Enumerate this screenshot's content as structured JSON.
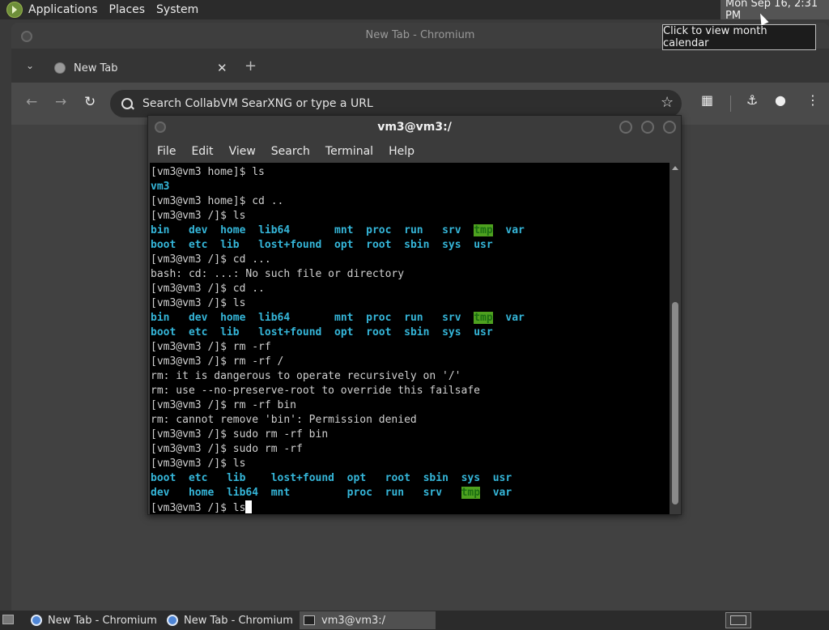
{
  "top_panel": {
    "menus": [
      "Applications",
      "Places",
      "System"
    ],
    "clock": "Mon Sep 16,  2:31 PM",
    "tooltip": "Click to view month calendar"
  },
  "chromium": {
    "window_title": "New Tab - Chromium",
    "tab_label": "New Tab",
    "tab_close": "✕",
    "new_tab": "+",
    "omnibox_placeholder": "Search CollabVM SearXNG or type a URL",
    "icons": [
      "back-arrow-icon",
      "forward-arrow-icon",
      "reload-icon",
      "search-icon",
      "bookmark-star-icon",
      "extensions-icon",
      "labs-flask-icon",
      "profile-icon",
      "menu-dots-icon"
    ]
  },
  "terminal": {
    "title": "vm3@vm3:/",
    "menus": [
      "File",
      "Edit",
      "View",
      "Search",
      "Terminal",
      "Help"
    ],
    "lines": [
      [
        {
          "t": "[vm3@vm3 home]$ ls"
        }
      ],
      [
        {
          "t": "vm3",
          "c": "dir"
        }
      ],
      [
        {
          "t": "[vm3@vm3 home]$ cd .."
        }
      ],
      [
        {
          "t": "[vm3@vm3 /]$ ls"
        }
      ],
      [
        {
          "t": "bin",
          "c": "dir"
        },
        {
          "t": "   "
        },
        {
          "t": "dev",
          "c": "dir"
        },
        {
          "t": "  "
        },
        {
          "t": "home",
          "c": "dir"
        },
        {
          "t": "  "
        },
        {
          "t": "lib64",
          "c": "dir"
        },
        {
          "t": "       "
        },
        {
          "t": "mnt",
          "c": "dir"
        },
        {
          "t": "  "
        },
        {
          "t": "proc",
          "c": "dir"
        },
        {
          "t": "  "
        },
        {
          "t": "run",
          "c": "dir"
        },
        {
          "t": "   "
        },
        {
          "t": "srv",
          "c": "dir"
        },
        {
          "t": "  "
        },
        {
          "t": "tmp",
          "c": "tmp"
        },
        {
          "t": "  "
        },
        {
          "t": "var",
          "c": "dir"
        }
      ],
      [
        {
          "t": "boot",
          "c": "dir"
        },
        {
          "t": "  "
        },
        {
          "t": "etc",
          "c": "dir"
        },
        {
          "t": "  "
        },
        {
          "t": "lib",
          "c": "dir"
        },
        {
          "t": "   "
        },
        {
          "t": "lost+found",
          "c": "dir"
        },
        {
          "t": "  "
        },
        {
          "t": "opt",
          "c": "dir"
        },
        {
          "t": "  "
        },
        {
          "t": "root",
          "c": "dir"
        },
        {
          "t": "  "
        },
        {
          "t": "sbin",
          "c": "dir"
        },
        {
          "t": "  "
        },
        {
          "t": "sys",
          "c": "dir"
        },
        {
          "t": "  "
        },
        {
          "t": "usr",
          "c": "dir"
        }
      ],
      [
        {
          "t": "[vm3@vm3 /]$ cd ..."
        }
      ],
      [
        {
          "t": "bash: cd: ...: No such file or directory"
        }
      ],
      [
        {
          "t": "[vm3@vm3 /]$ cd .."
        }
      ],
      [
        {
          "t": "[vm3@vm3 /]$ ls"
        }
      ],
      [
        {
          "t": "bin",
          "c": "dir"
        },
        {
          "t": "   "
        },
        {
          "t": "dev",
          "c": "dir"
        },
        {
          "t": "  "
        },
        {
          "t": "home",
          "c": "dir"
        },
        {
          "t": "  "
        },
        {
          "t": "lib64",
          "c": "dir"
        },
        {
          "t": "       "
        },
        {
          "t": "mnt",
          "c": "dir"
        },
        {
          "t": "  "
        },
        {
          "t": "proc",
          "c": "dir"
        },
        {
          "t": "  "
        },
        {
          "t": "run",
          "c": "dir"
        },
        {
          "t": "   "
        },
        {
          "t": "srv",
          "c": "dir"
        },
        {
          "t": "  "
        },
        {
          "t": "tmp",
          "c": "tmp"
        },
        {
          "t": "  "
        },
        {
          "t": "var",
          "c": "dir"
        }
      ],
      [
        {
          "t": "boot",
          "c": "dir"
        },
        {
          "t": "  "
        },
        {
          "t": "etc",
          "c": "dir"
        },
        {
          "t": "  "
        },
        {
          "t": "lib",
          "c": "dir"
        },
        {
          "t": "   "
        },
        {
          "t": "lost+found",
          "c": "dir"
        },
        {
          "t": "  "
        },
        {
          "t": "opt",
          "c": "dir"
        },
        {
          "t": "  "
        },
        {
          "t": "root",
          "c": "dir"
        },
        {
          "t": "  "
        },
        {
          "t": "sbin",
          "c": "dir"
        },
        {
          "t": "  "
        },
        {
          "t": "sys",
          "c": "dir"
        },
        {
          "t": "  "
        },
        {
          "t": "usr",
          "c": "dir"
        }
      ],
      [
        {
          "t": "[vm3@vm3 /]$ rm -rf"
        }
      ],
      [
        {
          "t": "[vm3@vm3 /]$ rm -rf /"
        }
      ],
      [
        {
          "t": "rm: it is dangerous to operate recursively on '/'"
        }
      ],
      [
        {
          "t": "rm: use --no-preserve-root to override this failsafe"
        }
      ],
      [
        {
          "t": "[vm3@vm3 /]$ rm -rf bin"
        }
      ],
      [
        {
          "t": "rm: cannot remove 'bin': Permission denied"
        }
      ],
      [
        {
          "t": "[vm3@vm3 /]$ sudo rm -rf bin"
        }
      ],
      [
        {
          "t": "[vm3@vm3 /]$ sudo rm -rf"
        }
      ],
      [
        {
          "t": "[vm3@vm3 /]$ ls"
        }
      ],
      [
        {
          "t": "boot",
          "c": "dir"
        },
        {
          "t": "  "
        },
        {
          "t": "etc",
          "c": "dir"
        },
        {
          "t": "   "
        },
        {
          "t": "lib",
          "c": "dir"
        },
        {
          "t": "    "
        },
        {
          "t": "lost+found",
          "c": "dir"
        },
        {
          "t": "  "
        },
        {
          "t": "opt",
          "c": "dir"
        },
        {
          "t": "   "
        },
        {
          "t": "root",
          "c": "dir"
        },
        {
          "t": "  "
        },
        {
          "t": "sbin",
          "c": "dir"
        },
        {
          "t": "  "
        },
        {
          "t": "sys",
          "c": "dir"
        },
        {
          "t": "  "
        },
        {
          "t": "usr",
          "c": "dir"
        }
      ],
      [
        {
          "t": "dev",
          "c": "dir"
        },
        {
          "t": "   "
        },
        {
          "t": "home",
          "c": "dir"
        },
        {
          "t": "  "
        },
        {
          "t": "lib64",
          "c": "dir"
        },
        {
          "t": "  "
        },
        {
          "t": "mnt",
          "c": "dir"
        },
        {
          "t": "         "
        },
        {
          "t": "proc",
          "c": "dir"
        },
        {
          "t": "  "
        },
        {
          "t": "run",
          "c": "dir"
        },
        {
          "t": "   "
        },
        {
          "t": "srv",
          "c": "dir"
        },
        {
          "t": "   "
        },
        {
          "t": "tmp",
          "c": "tmp"
        },
        {
          "t": "  "
        },
        {
          "t": "var",
          "c": "dir"
        }
      ],
      [
        {
          "t": "[vm3@vm3 /]$ ls"
        },
        {
          "cursor": true
        }
      ]
    ],
    "colors": {
      "dir": "#35b6d9",
      "tmp_fg": "#1b6e12",
      "tmp_bg": "#4ea11f"
    }
  },
  "taskbar": {
    "items": [
      {
        "label": "New Tab - Chromium",
        "icon": "chromium-icon",
        "active": false
      },
      {
        "label": "New Tab - Chromium",
        "icon": "chromium-icon",
        "active": false
      },
      {
        "label": "vm3@vm3:/",
        "icon": "terminal-icon",
        "active": true
      }
    ]
  }
}
